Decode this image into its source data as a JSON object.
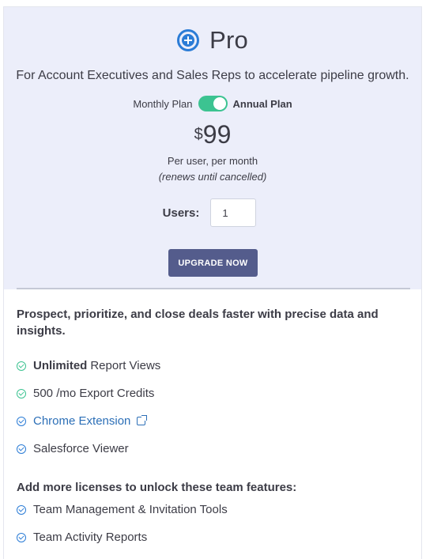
{
  "plan": {
    "name": "Pro",
    "icon": "plus-circle-icon",
    "subtitle": "For Account Executives and Sales Reps to accelerate pipeline growth."
  },
  "billing": {
    "monthly_label": "Monthly Plan",
    "annual_label": "Annual Plan",
    "toggle_state": "annual",
    "toggle_color": "#3cc391"
  },
  "pricing": {
    "currency": "$",
    "amount": "99",
    "per_user": "Per user, per month",
    "renews": "(renews until cancelled)"
  },
  "users": {
    "label": "Users:",
    "value": "1"
  },
  "upgrade_button": {
    "label": "UPGRADE NOW",
    "color": "#545c8c"
  },
  "description": "Prospect, prioritize, and close deals faster with precise data and insights.",
  "features": [
    {
      "bold": "Unlimited",
      "text": "Report Views",
      "icon": "check-circle-icon"
    },
    {
      "bold": "",
      "text": "500 /mo Export Credits",
      "icon": "check-circle-icon"
    },
    {
      "bold": "",
      "text": "Chrome Extension",
      "icon": "check-circle-icon",
      "link_icon": "external-link-icon"
    },
    {
      "bold": "",
      "text": "Salesforce Viewer",
      "icon": "check-circle-icon"
    }
  ],
  "team_section": {
    "heading": "Add more licenses to unlock these team features:",
    "items": [
      {
        "text": "Team Management & Invitation Tools",
        "icon": "check-circle-icon"
      },
      {
        "text": "Team Activity Reports",
        "icon": "check-circle-icon"
      }
    ]
  },
  "colors": {
    "header_bg": "#eceefa",
    "accent_blue": "#2b7cd6",
    "link_blue": "#2c6fb7",
    "check_green": "#3cc391"
  }
}
